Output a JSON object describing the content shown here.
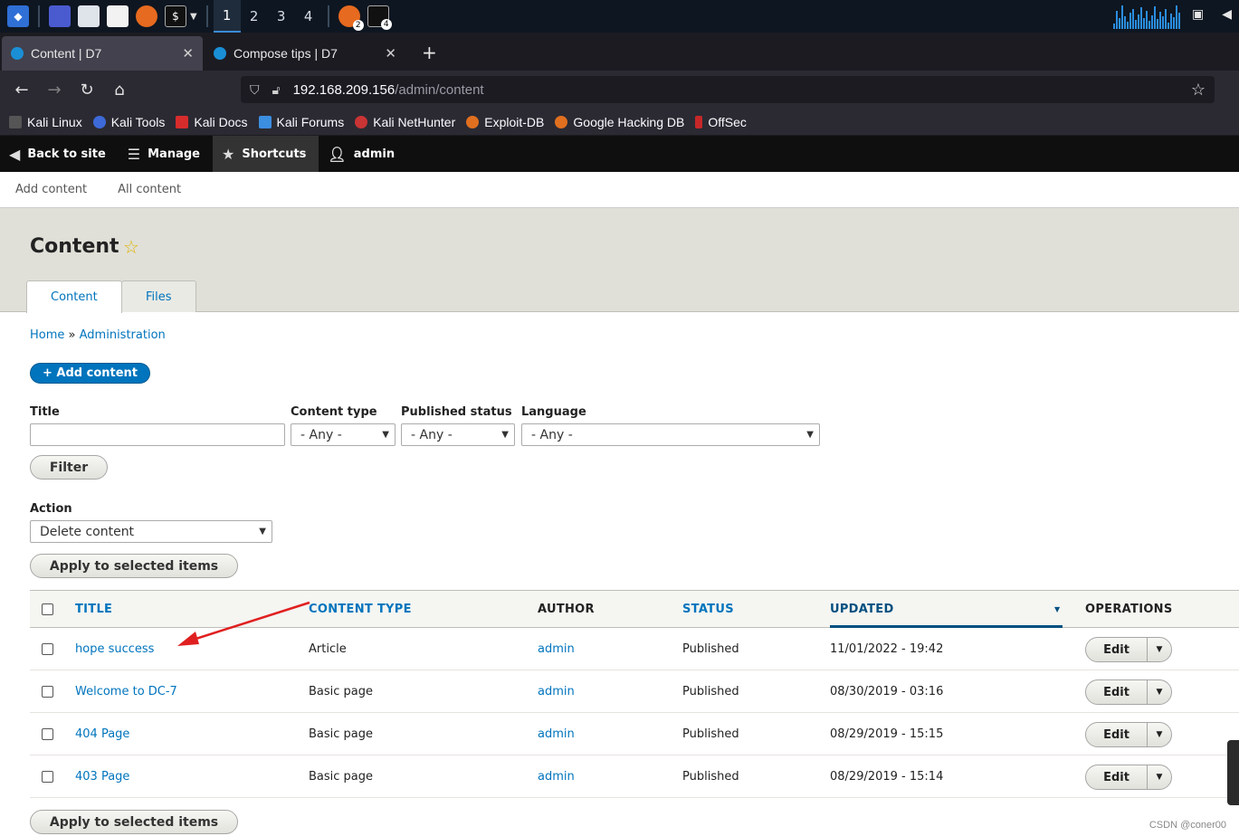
{
  "taskbar": {
    "workspaces": [
      "1",
      "2",
      "3",
      "4"
    ],
    "active_workspace": "1",
    "badges": [
      "2",
      "4"
    ]
  },
  "browser": {
    "tabs": [
      {
        "title": "Content | D7",
        "active": true
      },
      {
        "title": "Compose tips | D7",
        "active": false
      }
    ],
    "url_host": "192.168.209.156",
    "url_path": "/admin/content",
    "bookmarks": [
      "Kali Linux",
      "Kali Tools",
      "Kali Docs",
      "Kali Forums",
      "Kali NetHunter",
      "Exploit-DB",
      "Google Hacking DB",
      "OffSec"
    ]
  },
  "toolbar": {
    "back": "Back to site",
    "manage": "Manage",
    "shortcuts": "Shortcuts",
    "user": "admin",
    "tray": [
      "Add content",
      "All content"
    ]
  },
  "page": {
    "title": "Content",
    "tabs": [
      "Content",
      "Files"
    ],
    "breadcrumb": {
      "home": "Home",
      "sep": "»",
      "admin": "Administration"
    },
    "add_button": "+ Add content"
  },
  "filters": {
    "title_label": "Title",
    "title_value": "",
    "type_label": "Content type",
    "type_value": "- Any -",
    "status_label": "Published status",
    "status_value": "- Any -",
    "language_label": "Language",
    "language_value": "- Any -",
    "filter_button": "Filter"
  },
  "bulk": {
    "action_label": "Action",
    "action_value": "Delete content",
    "apply_button": "Apply to selected items"
  },
  "table": {
    "headers": {
      "title": "TITLE",
      "type": "CONTENT TYPE",
      "author": "AUTHOR",
      "status": "STATUS",
      "updated": "UPDATED",
      "operations": "OPERATIONS"
    },
    "rows": [
      {
        "title": "hope success",
        "type": "Article",
        "author": "admin",
        "status": "Published",
        "updated": "11/01/2022 - 19:42",
        "op": "Edit"
      },
      {
        "title": "Welcome to DC-7",
        "type": "Basic page",
        "author": "admin",
        "status": "Published",
        "updated": "08/30/2019 - 03:16",
        "op": "Edit"
      },
      {
        "title": "404 Page",
        "type": "Basic page",
        "author": "admin",
        "status": "Published",
        "updated": "08/29/2019 - 15:15",
        "op": "Edit"
      },
      {
        "title": "403 Page",
        "type": "Basic page",
        "author": "admin",
        "status": "Published",
        "updated": "08/29/2019 - 15:14",
        "op": "Edit"
      }
    ]
  },
  "watermark": "CSDN @coner00"
}
